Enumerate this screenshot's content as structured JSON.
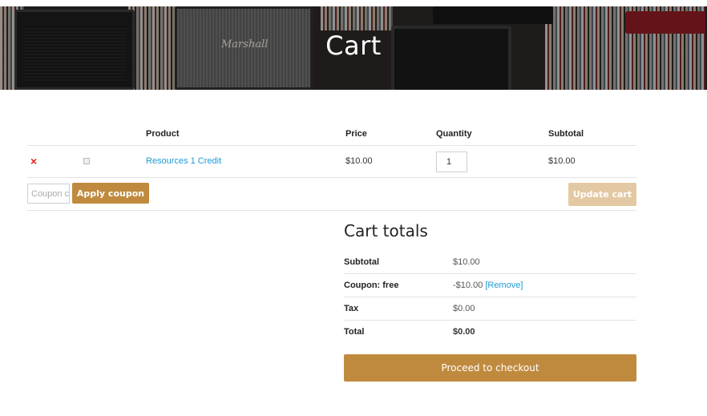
{
  "page": {
    "title": "Cart",
    "banner_brand": "Marshall"
  },
  "cart": {
    "headers": {
      "product": "Product",
      "price": "Price",
      "quantity": "Quantity",
      "subtotal": "Subtotal"
    },
    "items": [
      {
        "remove_icon": "×",
        "name": "Resources 1 Credit",
        "price": "$10.00",
        "quantity": "1",
        "subtotal": "$10.00"
      }
    ],
    "coupon_placeholder": "Coupon code",
    "apply_coupon_label": "Apply coupon",
    "update_cart_label": "Update cart"
  },
  "totals": {
    "heading": "Cart totals",
    "subtotal_label": "Subtotal",
    "subtotal_value": "$10.00",
    "coupon_label": "Coupon: free",
    "coupon_value": "-$10.00",
    "coupon_remove": "[Remove]",
    "tax_label": "Tax",
    "tax_value": "$0.00",
    "total_label": "Total",
    "total_value": "$0.00",
    "checkout_label": "Proceed to checkout"
  },
  "colors": {
    "accent": "#c08a3e",
    "accent_disabled": "#e3c9a3",
    "link": "#1e9bd7",
    "remove": "#e2231a"
  },
  "icons": {
    "remove": "close-icon",
    "thumbnail": "image-placeholder-icon"
  }
}
